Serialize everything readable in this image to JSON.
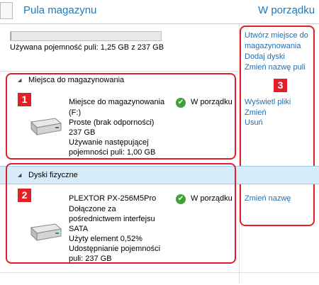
{
  "header": {
    "title": "Pula magazynu",
    "status": "W porządku"
  },
  "capacity": {
    "text": "Używana pojemność puli: 1,25 GB z 237 GB",
    "used_fraction": 0.005
  },
  "actions": [
    {
      "label": "Utwórz miejsce do"
    },
    {
      "label": "magazynowania"
    },
    {
      "label": "Dodaj dyski"
    },
    {
      "label": "Zmień nazwę puli"
    }
  ],
  "storage_spaces": {
    "section_title": "Miejsca do magazynowania",
    "badge": "1",
    "lines": [
      "Miejsce do magazynowania",
      "(F:)",
      "Proste (brak odporności)",
      "237 GB",
      "Używanie następującej",
      "pojemności puli: 1,00 GB"
    ],
    "status": "W porządku",
    "links": [
      "Wyświetl pliki",
      "Zmień",
      "Usuń"
    ]
  },
  "physical_disks": {
    "section_title": "Dyski fizyczne",
    "badge": "2",
    "lines": [
      "PLEXTOR PX-256M5Pro",
      "Dołączone za",
      "pośrednictwem interfejsu",
      "SATA",
      "Użyty element 0,52%",
      "Udostępnianie pojemności",
      "puli: 237 GB"
    ],
    "status": "W porządku",
    "link": "Zmień nazwę"
  },
  "actions_badge": "3",
  "icons": {
    "checkmark": "✔",
    "collapse": "◢"
  }
}
